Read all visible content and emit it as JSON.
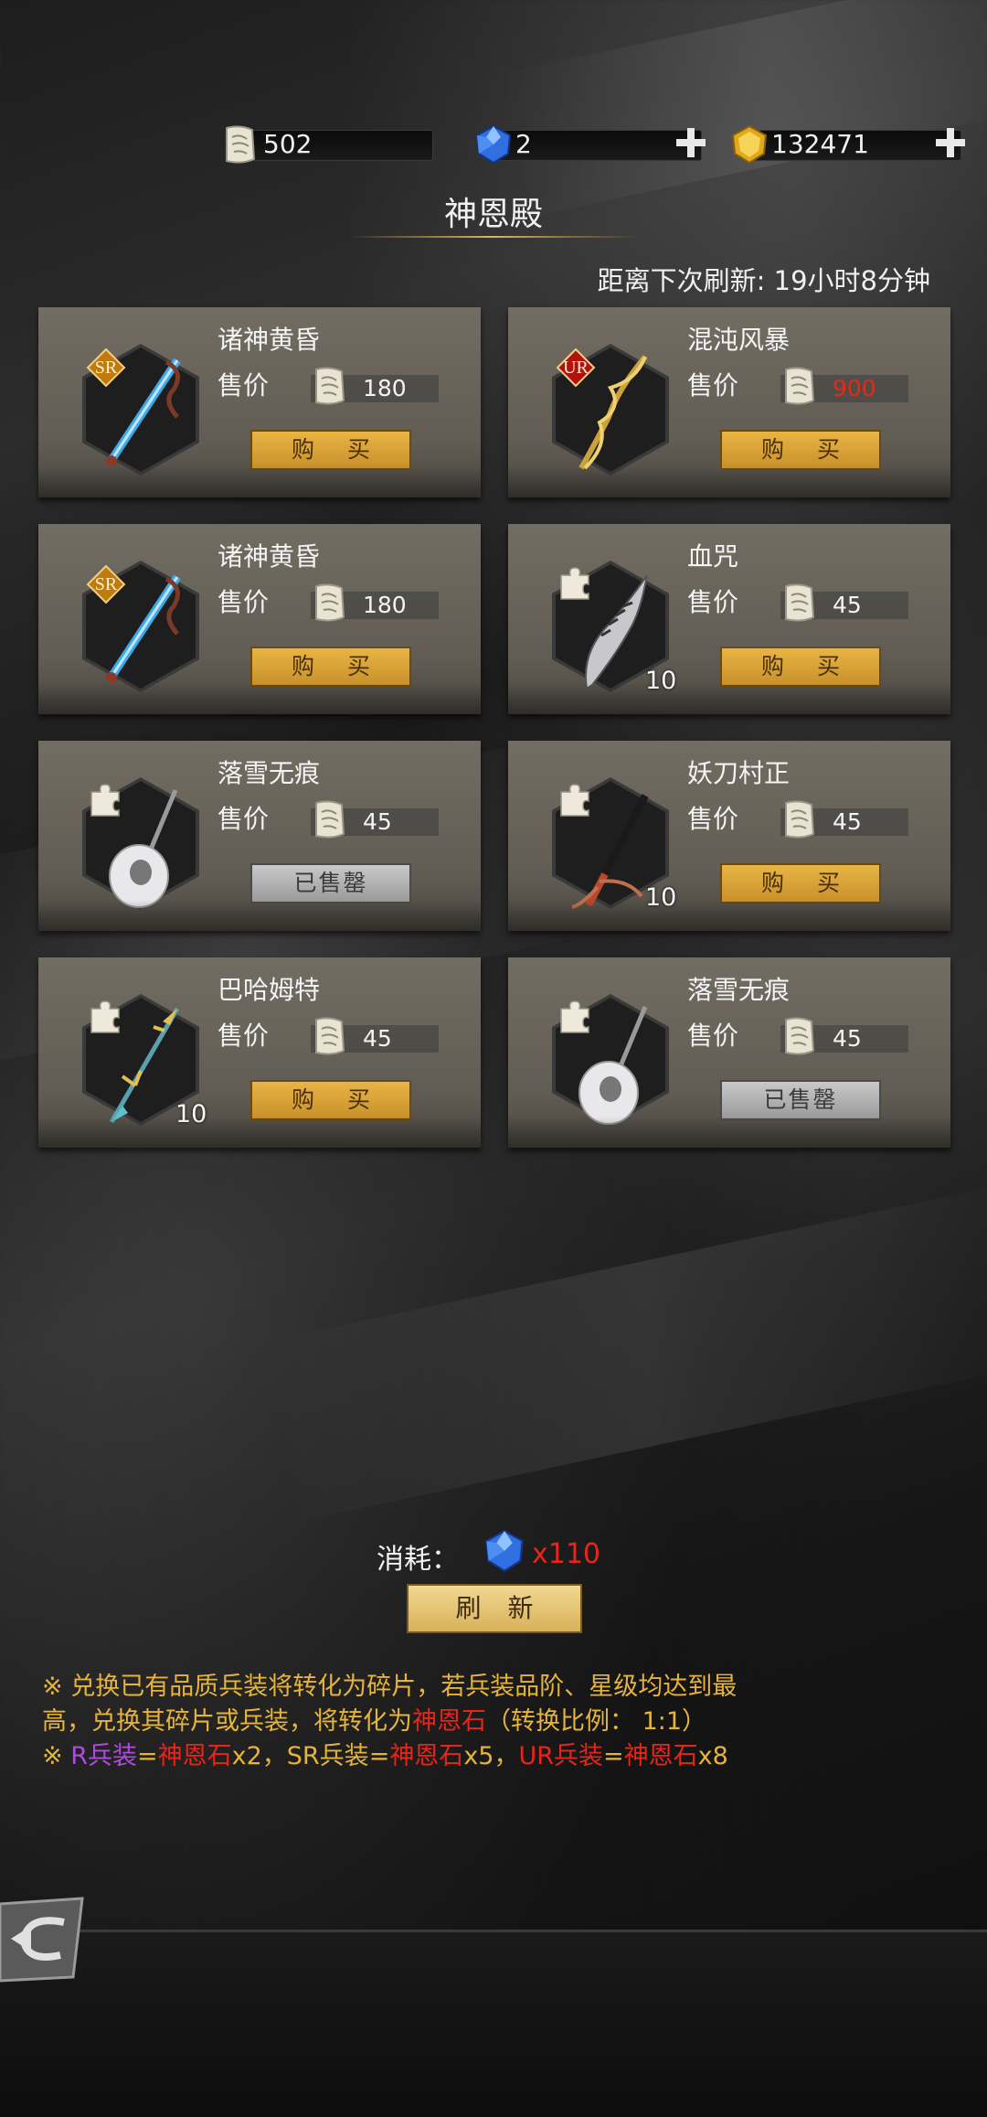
{
  "currencies": [
    {
      "icon": "scroll-fragment-icon",
      "value": "502",
      "has_plus": false
    },
    {
      "icon": "blue-gem-icon",
      "value": "2",
      "has_plus": true
    },
    {
      "icon": "gold-coin-icon",
      "value": "132471",
      "has_plus": true
    }
  ],
  "title": "神恩殿",
  "refresh_time": "距离下次刷新: 19小时8分钟",
  "items": [
    {
      "name": "诸神黄昏",
      "price_label": "售价",
      "price": "180",
      "price_color": "white",
      "badge": "SR",
      "qty": "",
      "button": "购 买",
      "sold": false,
      "weapon": "blue-sword-icon"
    },
    {
      "name": "混沌风暴",
      "price_label": "售价",
      "price": "900",
      "price_color": "red",
      "badge": "UR",
      "qty": "",
      "button": "购 买",
      "sold": false,
      "weapon": "gold-spear-icon"
    },
    {
      "name": "诸神黄昏",
      "price_label": "售价",
      "price": "180",
      "price_color": "white",
      "badge": "SR",
      "qty": "",
      "button": "购 买",
      "sold": false,
      "weapon": "blue-sword-icon"
    },
    {
      "name": "血咒",
      "price_label": "售价",
      "price": "45",
      "price_color": "white",
      "badge": "puzzle",
      "qty": "10",
      "button": "购 买",
      "sold": false,
      "weapon": "serrated-blade-icon"
    },
    {
      "name": "落雪无痕",
      "price_label": "售价",
      "price": "45",
      "price_color": "white",
      "badge": "puzzle",
      "qty": "",
      "button": "已售罄",
      "sold": true,
      "weapon": "feather-mace-icon"
    },
    {
      "name": "妖刀村正",
      "price_label": "售价",
      "price": "45",
      "price_color": "white",
      "badge": "puzzle",
      "qty": "10",
      "button": "购 买",
      "sold": false,
      "weapon": "katana-icon"
    },
    {
      "name": "巴哈姆特",
      "price_label": "售价",
      "price": "45",
      "price_color": "white",
      "badge": "puzzle",
      "qty": "10",
      "button": "购 买",
      "sold": false,
      "weapon": "dragon-spear-icon"
    },
    {
      "name": "落雪无痕",
      "price_label": "售价",
      "price": "45",
      "price_color": "white",
      "badge": "puzzle",
      "qty": "",
      "button": "已售罄",
      "sold": true,
      "weapon": "feather-mace-icon"
    }
  ],
  "cost": {
    "label": "消耗：",
    "value": "x110"
  },
  "refresh_button": "刷 新",
  "notes": {
    "line1": "※ 兑换已有品质兵装将转化为碎片，若兵装品阶、星级均达到最",
    "line2a": "高，兑换其碎片或兵装，将转化为",
    "line2b": "神恩石",
    "line2c": "（转换比例： 1:1）",
    "line3_prefix": "※ ",
    "r_label": "R兵装",
    "eq": "=",
    "stone": "神恩石",
    "r_mult": "x2，",
    "sr_label": "SR兵装",
    "sr_mult": "x5，",
    "ur_label": "UR兵装",
    "ur_mult": "x8"
  },
  "colors": {
    "accent": "#e6b43a",
    "red": "#e8251a",
    "purple": "#b04ae0",
    "button_gold": "#d9a23a"
  }
}
